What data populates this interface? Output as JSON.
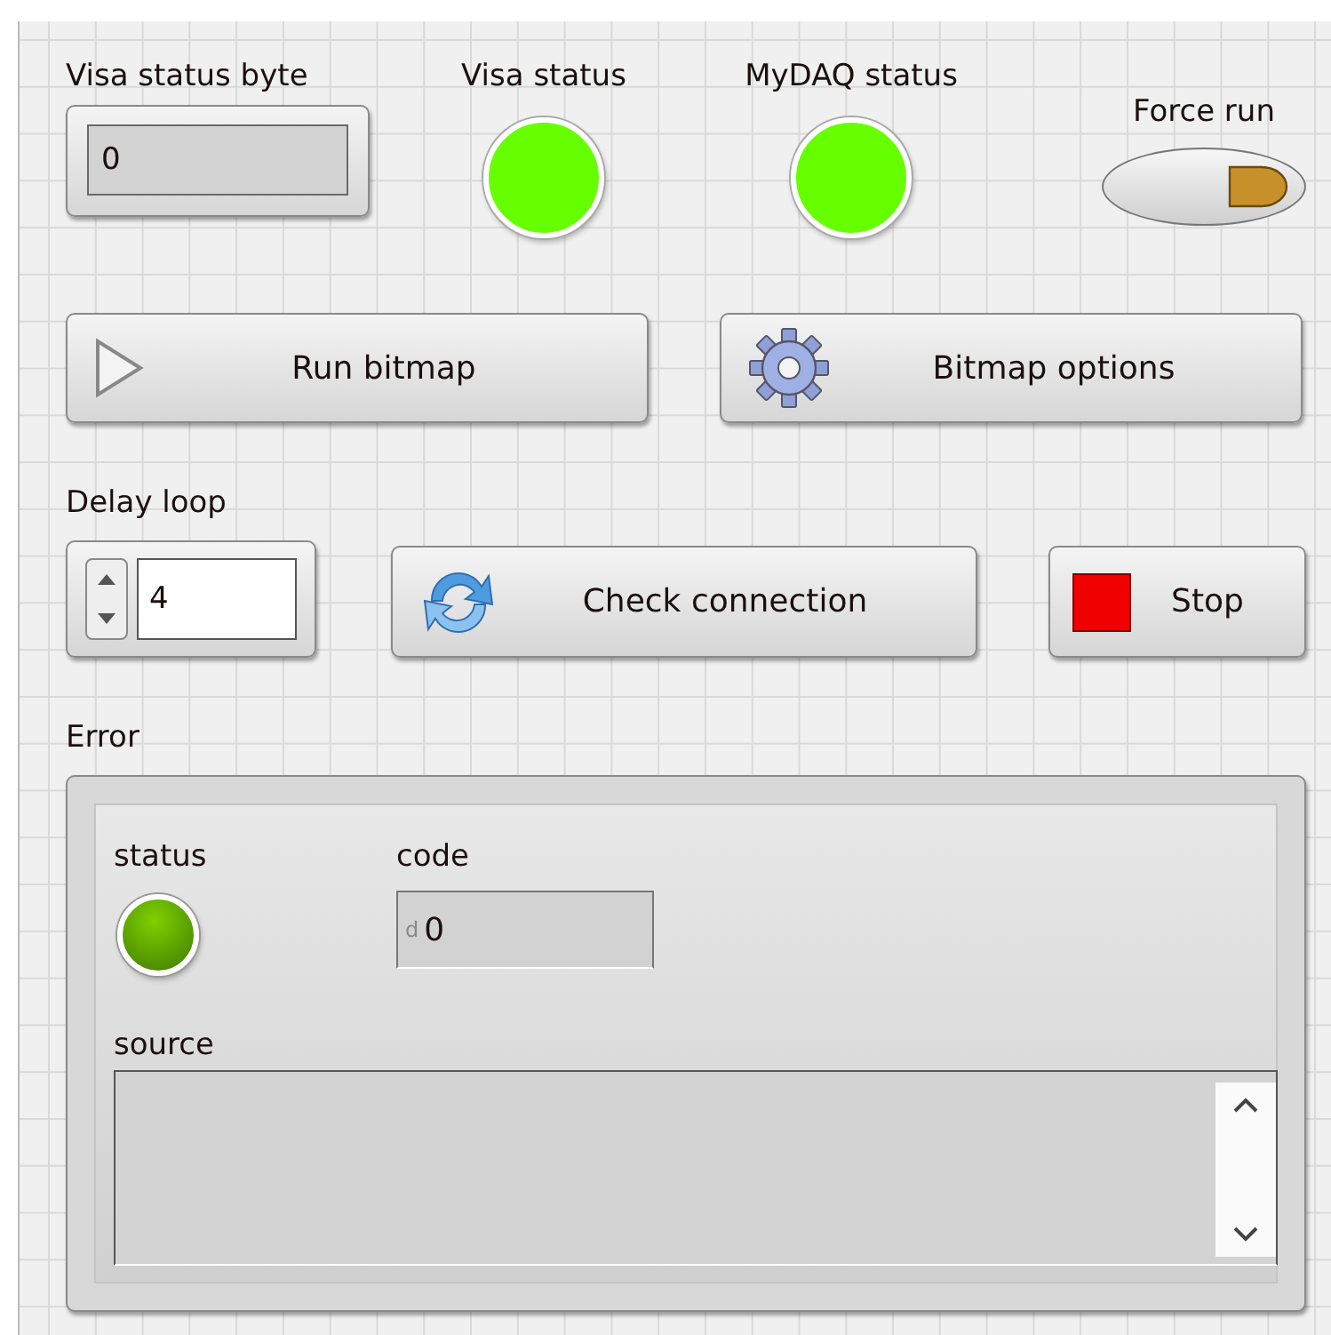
{
  "visa_status_byte": {
    "label": "Visa status byte",
    "value": "0"
  },
  "indicators": [
    {
      "label": "Visa status",
      "on": true
    },
    {
      "label": "MyDAQ status",
      "on": true
    }
  ],
  "force_run": {
    "label": "Force run",
    "on": true
  },
  "buttons": [
    {
      "label": "Run bitmap",
      "kind": "play"
    },
    {
      "label": "Bitmap options",
      "kind": "gear"
    }
  ],
  "delay_loop": {
    "label": "Delay loop",
    "value": "4"
  },
  "loop_buttons": [
    {
      "label": "Check connection",
      "kind": "refresh"
    },
    {
      "label": "Stop",
      "kind": "stop"
    }
  ],
  "error": {
    "label": "Error",
    "status": {
      "label": "status",
      "on": false
    },
    "code": {
      "label": "code",
      "radix": "d",
      "value": "0"
    },
    "source": {
      "label": "source"
    }
  }
}
